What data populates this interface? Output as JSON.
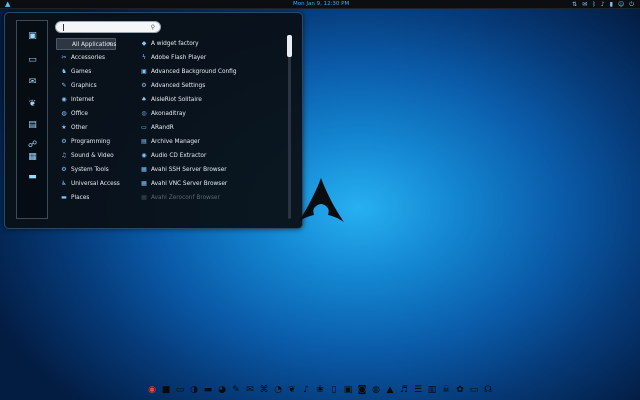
{
  "topbar": {
    "activities_icon": "arch-icon",
    "clock": "Mon Jan  9, 12:30 PM",
    "tray": [
      {
        "name": "network-icon",
        "glyph": "⇅"
      },
      {
        "name": "chat-icon",
        "glyph": "✉"
      },
      {
        "name": "bluetooth-icon",
        "glyph": "ᛒ"
      },
      {
        "name": "volume-icon",
        "glyph": "♪"
      },
      {
        "name": "battery-icon",
        "glyph": "▮"
      },
      {
        "name": "user-icon",
        "glyph": "☺"
      },
      {
        "name": "power-icon",
        "glyph": "⏻"
      }
    ]
  },
  "search": {
    "placeholder": "",
    "value": ""
  },
  "categories": [
    {
      "label": "All Applications",
      "icon": "grid-icon",
      "glyph": "",
      "selected": true
    },
    {
      "label": "Accessories",
      "icon": "accessories-icon",
      "glyph": "✂"
    },
    {
      "label": "Games",
      "icon": "gamepad-icon",
      "glyph": "♞"
    },
    {
      "label": "Graphics",
      "icon": "brush-icon",
      "glyph": "✎"
    },
    {
      "label": "Internet",
      "icon": "globe-icon",
      "glyph": "◉"
    },
    {
      "label": "Office",
      "icon": "office-icon",
      "glyph": "◍"
    },
    {
      "label": "Other",
      "icon": "star-icon",
      "glyph": "★"
    },
    {
      "label": "Programming",
      "icon": "code-icon",
      "glyph": "⚙"
    },
    {
      "label": "Sound & Video",
      "icon": "media-icon",
      "glyph": "♫"
    },
    {
      "label": "System Tools",
      "icon": "system-icon",
      "glyph": "⚙"
    },
    {
      "label": "Universal Access",
      "icon": "accessibility-icon",
      "glyph": "♿"
    },
    {
      "label": "Places",
      "icon": "folder-icon",
      "glyph": "▬"
    }
  ],
  "apps": [
    {
      "label": "A widget factory",
      "icon": "widget-icon",
      "glyph": "◆"
    },
    {
      "label": "Adobe Flash Player",
      "icon": "flash-icon",
      "glyph": "ϟ"
    },
    {
      "label": "Advanced Background Config",
      "icon": "wallpaper-icon",
      "glyph": "▣"
    },
    {
      "label": "Advanced Settings",
      "icon": "settings-icon",
      "glyph": "⚙"
    },
    {
      "label": "AisleRiot Solitaire",
      "icon": "cards-icon",
      "glyph": "♠"
    },
    {
      "label": "Akonaditray",
      "icon": "akonadi-icon",
      "glyph": "◎"
    },
    {
      "label": "ARandR",
      "icon": "display-icon",
      "glyph": "▭"
    },
    {
      "label": "Archive Manager",
      "icon": "archive-icon",
      "glyph": "▤"
    },
    {
      "label": "Audio CD Extractor",
      "icon": "cd-icon",
      "glyph": "◉"
    },
    {
      "label": "Avahi SSH Server Browser",
      "icon": "server-icon",
      "glyph": "▦"
    },
    {
      "label": "Avahi VNC Server Browser",
      "icon": "server-icon",
      "glyph": "▦"
    },
    {
      "label": "Avahi Zeroconf Browser",
      "icon": "server-icon",
      "glyph": "▦",
      "faded": true
    }
  ],
  "rail_icons": [
    {
      "name": "desktop-icon",
      "glyph": "▣"
    },
    {
      "name": "terminal-icon",
      "glyph": "▭"
    },
    {
      "name": "mail-icon",
      "glyph": "✉"
    },
    {
      "name": "chat-icon",
      "glyph": "❦"
    },
    {
      "name": "document-icon",
      "glyph": "▤"
    },
    {
      "name": "users-icon",
      "glyph": "☍"
    },
    {
      "name": "calendar-icon",
      "glyph": "▦"
    },
    {
      "name": "monitor-icon",
      "glyph": "▬"
    }
  ],
  "dock_icons": [
    {
      "name": "firefox-icon",
      "glyph": "◉"
    },
    {
      "name": "window-icon",
      "glyph": "■"
    },
    {
      "name": "terminal-icon",
      "glyph": "▭"
    },
    {
      "name": "browser-icon",
      "glyph": "◑"
    },
    {
      "name": "files-icon",
      "glyph": "▬"
    },
    {
      "name": "chrome-icon",
      "glyph": "◕"
    },
    {
      "name": "edit-icon",
      "glyph": "✎"
    },
    {
      "name": "mail-icon",
      "glyph": "✉"
    },
    {
      "name": "network-icon",
      "glyph": "⌘"
    },
    {
      "name": "thunderbird-icon",
      "glyph": "◔"
    },
    {
      "name": "chat-icon",
      "glyph": "❦"
    },
    {
      "name": "mic-icon",
      "glyph": "♪"
    },
    {
      "name": "pidgin-icon",
      "glyph": "❀"
    },
    {
      "name": "document-icon",
      "glyph": "▯"
    },
    {
      "name": "image-icon",
      "glyph": "▣"
    },
    {
      "name": "media-icon",
      "glyph": "◙"
    },
    {
      "name": "steam-icon",
      "glyph": "◍"
    },
    {
      "name": "vlc-icon",
      "glyph": "▲"
    },
    {
      "name": "music-icon",
      "glyph": "♬"
    },
    {
      "name": "sliders-icon",
      "glyph": "☰"
    },
    {
      "name": "equalizer-icon",
      "glyph": "▥"
    },
    {
      "name": "alien-icon",
      "glyph": "☠"
    },
    {
      "name": "android-icon",
      "glyph": "✿"
    },
    {
      "name": "display-icon",
      "glyph": "▭"
    },
    {
      "name": "headphones-icon",
      "glyph": "☊"
    }
  ],
  "colors": {
    "accent": "#3fa9f5",
    "panel": "#0c0e11",
    "menu_bg": "#0a1016"
  }
}
